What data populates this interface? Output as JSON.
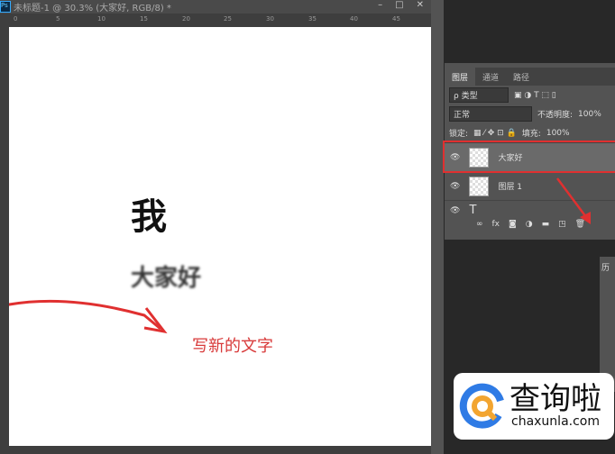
{
  "window": {
    "title": "未标题-1 @ 30.3% (大家好, RGB/8) *",
    "app_icon": "Ps",
    "minimize": "–",
    "maximize": "□",
    "close": "✕"
  },
  "ruler": [
    "0",
    "5",
    "10",
    "15",
    "20",
    "25",
    "30",
    "35",
    "40",
    "45"
  ],
  "canvas": {
    "char_large": "我",
    "blurred_text": "大家好",
    "annotation": "写新的文字"
  },
  "layers_panel": {
    "tabs": [
      "图层",
      "通道",
      "路径"
    ],
    "filter_kind": "ρ 类型",
    "blend_mode": "正常",
    "opacity_label": "不透明度:",
    "opacity": "100%",
    "lock_label": "锁定:",
    "fill_label": "填充:",
    "fill": "100%",
    "layers": [
      {
        "name": "大家好",
        "selected": true
      },
      {
        "name": "图层 1",
        "selected": false
      },
      {
        "name": "",
        "type": "text"
      }
    ],
    "footer_icons": [
      "link-icon",
      "fx-icon",
      "mask-icon",
      "adjustment-icon",
      "folder-icon",
      "new-layer-icon",
      "trash-icon"
    ],
    "fx": "fx"
  },
  "history_panel": {
    "tab": "历"
  },
  "watermark": {
    "cn": "查询啦",
    "en": "chaxunla.com"
  },
  "colors": {
    "highlight": "#e03030"
  }
}
